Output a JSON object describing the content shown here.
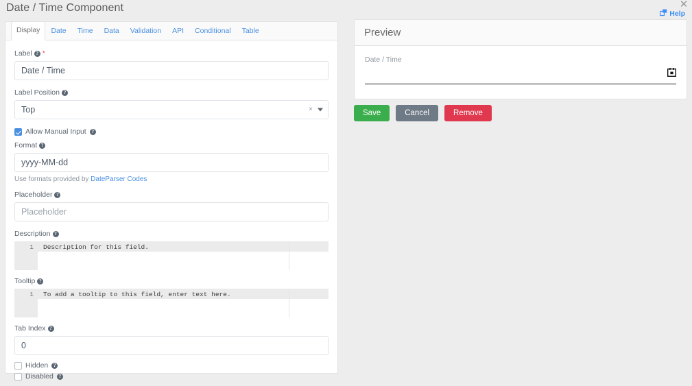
{
  "header": {
    "title": "Date / Time Component",
    "help_label": "Help",
    "help_icon": "windows-external-icon",
    "close_icon": "close-icon"
  },
  "tabs": [
    {
      "label": "Display",
      "active": true
    },
    {
      "label": "Date",
      "active": false
    },
    {
      "label": "Time",
      "active": false
    },
    {
      "label": "Data",
      "active": false
    },
    {
      "label": "Validation",
      "active": false
    },
    {
      "label": "API",
      "active": false
    },
    {
      "label": "Conditional",
      "active": false
    },
    {
      "label": "Table",
      "active": false
    }
  ],
  "form": {
    "label": {
      "label": "Label",
      "required_marker": "*",
      "value": "Date / Time"
    },
    "label_position": {
      "label": "Label Position",
      "value": "Top",
      "clear_glyph": "×"
    },
    "allow_manual_input": {
      "label": "Allow Manual Input",
      "checked": true
    },
    "format": {
      "label": "Format",
      "value": "yyyy-MM-dd",
      "help_prefix": "Use formats provided by ",
      "help_link": "DateParser Codes"
    },
    "placeholder": {
      "label": "Placeholder",
      "value": "",
      "placeholder": "Placeholder"
    },
    "description": {
      "label": "Description",
      "line_number": "1",
      "value": "Description for this field."
    },
    "tooltip": {
      "label": "Tooltip",
      "line_number": "1",
      "value": "To add a tooltip to this field, enter text here."
    },
    "tab_index": {
      "label": "Tab Index",
      "value": "0"
    },
    "hidden": {
      "label": "Hidden",
      "checked": false
    },
    "disabled": {
      "label": "Disabled",
      "checked": false
    }
  },
  "preview": {
    "title": "Preview",
    "field_label": "Date / Time",
    "field_value": "",
    "calendar_icon": "calendar-icon"
  },
  "actions": {
    "save": "Save",
    "cancel": "Cancel",
    "remove": "Remove"
  },
  "colors": {
    "accent_blue": "#4a90e2",
    "save_green": "#3aae4c",
    "cancel_gray": "#6e7a86",
    "remove_red": "#e0394f",
    "required_red": "#e8455a",
    "page_bg": "#ededed"
  }
}
